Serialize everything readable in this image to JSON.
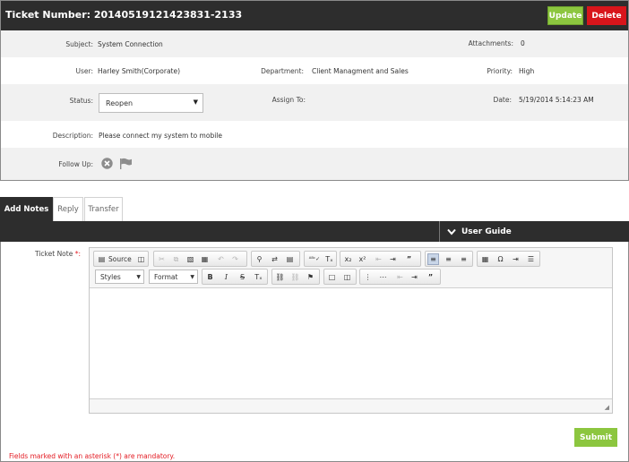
{
  "ticket": {
    "title": "Ticket Number: 20140519121423831-2133",
    "update_label": "Update",
    "delete_label": "Delete"
  },
  "colors": {
    "update": "#8cc63f",
    "delete": "#d8151b",
    "header": "#2d2d2d",
    "mandatory": "#e31b23"
  },
  "fields": {
    "subject_label": "Subject:",
    "subject": "System Connection",
    "attachments_label": "Attachments:",
    "attachments": "0",
    "user_label": "User:",
    "user": "Harley Smith(Corporate)",
    "department_label": "Department:",
    "department": "Client Managment and Sales",
    "priority_label": "Priority:",
    "priority": "High",
    "status_label": "Status:",
    "status": "Reopen",
    "assign_label": "Assign To:",
    "date_label": "Date:",
    "date": "5/19/2014 5:14:23 AM",
    "description_label": "Description:",
    "description": "Please connect my system to mobile",
    "followup_label": "Follow Up:"
  },
  "followup_icons": [
    "close-circle-icon",
    "flag-icon"
  ],
  "tabs": [
    {
      "label": "Add Notes",
      "active": true
    },
    {
      "label": "Reply",
      "active": false
    },
    {
      "label": "Transfer",
      "active": false
    }
  ],
  "user_guide": {
    "label": "User Guide",
    "icon": "chevron-down-icon"
  },
  "editor": {
    "label": "Ticket Note",
    "required_mark": "*:",
    "source_label": "Source",
    "styles_label": "Styles",
    "format_label": "Format"
  },
  "submit_label": "Submit",
  "mandatory_note": "Fields marked with an asterisk (*) are mandatory."
}
